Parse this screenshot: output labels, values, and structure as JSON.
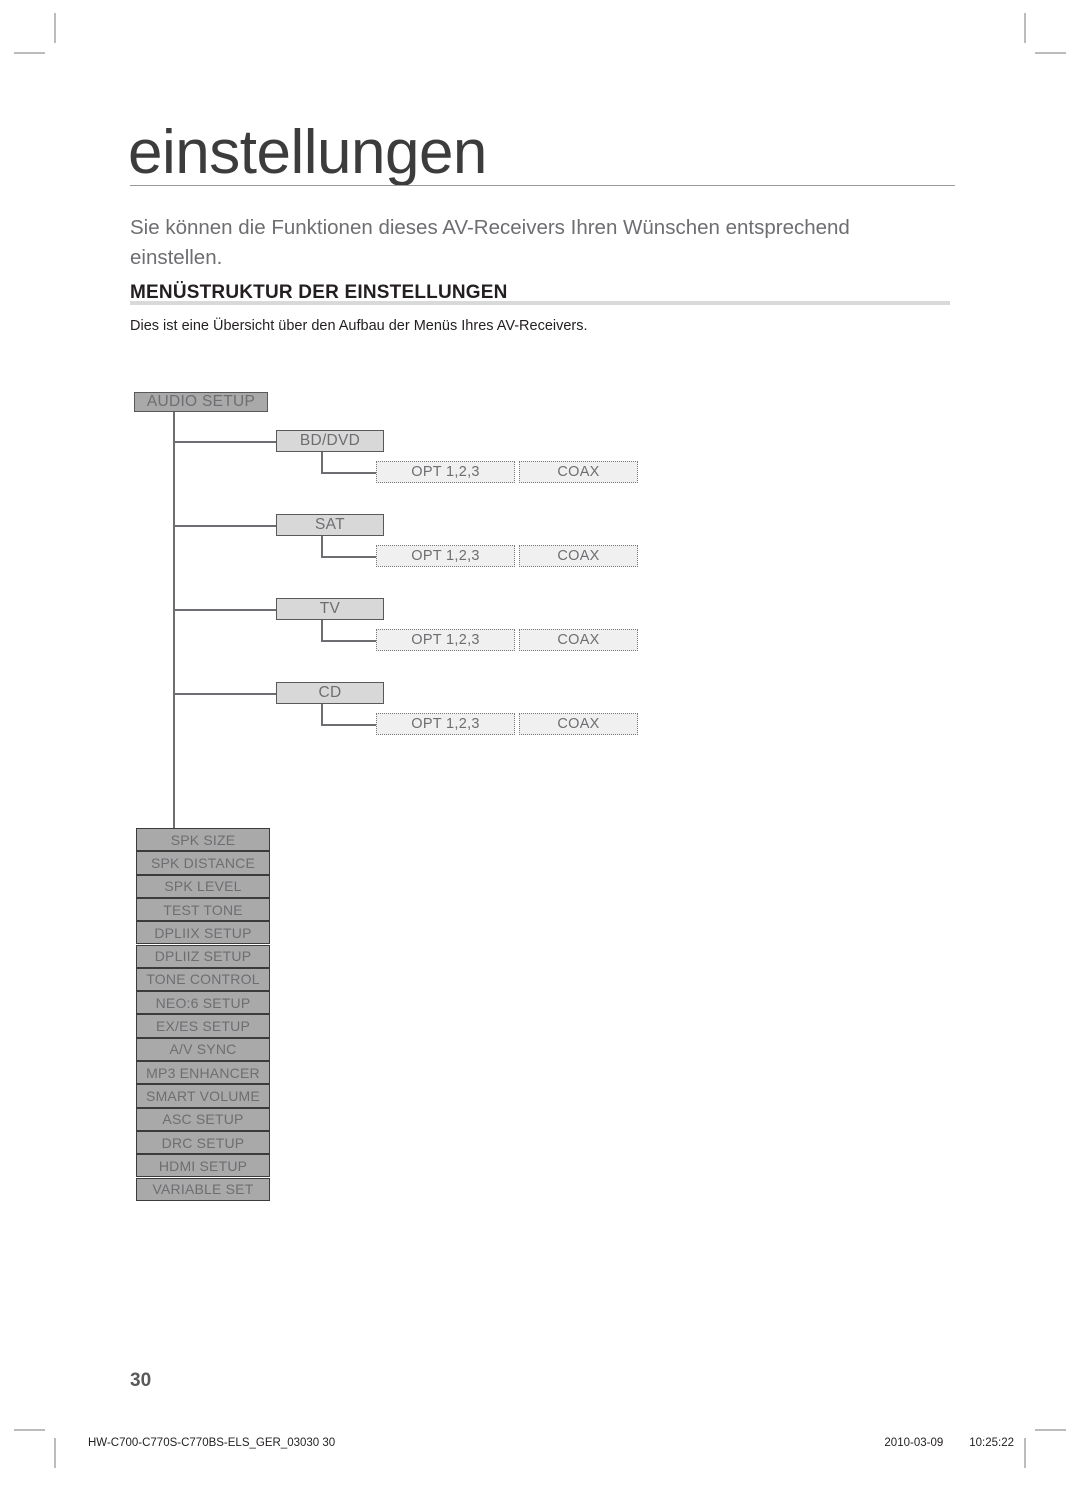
{
  "page": {
    "chapter_title": "einstellungen",
    "intro": "Sie können die Funktionen dieses AV-Receivers Ihren Wünschen entsprechend einstellen.",
    "section_heading": "MENÜSTRUKTUR DER EINSTELLUNGEN",
    "section_description": "Dies ist eine Übersicht über den Aufbau der Menüs Ihres AV-Receivers.",
    "page_number": "30"
  },
  "footer": {
    "document_id": "HW-C700-C770S-C770BS-ELS_GER_03030   30",
    "date": "2010-03-09",
    "time": "10:25:22"
  },
  "diagram": {
    "root": {
      "label": "AUDIO SETUP"
    },
    "sources": [
      {
        "label": "BD/DVD",
        "options": [
          {
            "label": "OPT 1,2,3"
          },
          {
            "label": "COAX"
          }
        ]
      },
      {
        "label": "SAT",
        "options": [
          {
            "label": "OPT 1,2,3"
          },
          {
            "label": "COAX"
          }
        ]
      },
      {
        "label": "TV",
        "options": [
          {
            "label": "OPT 1,2,3"
          },
          {
            "label": "COAX"
          }
        ]
      },
      {
        "label": "CD",
        "options": [
          {
            "label": "OPT 1,2,3"
          },
          {
            "label": "COAX"
          }
        ]
      }
    ],
    "menu_items": [
      {
        "label": "SPK SIZE"
      },
      {
        "label": "SPK DISTANCE"
      },
      {
        "label": "SPK LEVEL"
      },
      {
        "label": "TEST TONE"
      },
      {
        "label": "DPLIIX SETUP"
      },
      {
        "label": "DPLIIZ SETUP"
      },
      {
        "label": "TONE CONTROL"
      },
      {
        "label": "NEO:6 SETUP"
      },
      {
        "label": "EX/ES SETUP"
      },
      {
        "label": "A/V SYNC"
      },
      {
        "label": "MP3 ENHANCER"
      },
      {
        "label": "SMART VOLUME"
      },
      {
        "label": "ASC SETUP"
      },
      {
        "label": "DRC SETUP"
      },
      {
        "label": "HDMI SETUP"
      },
      {
        "label": "VARIABLE SET"
      }
    ]
  },
  "colors": {
    "root_fill": "#a9a9a9",
    "level2_fill": "#d8d8d8",
    "level3_fill": "#f0f0f0",
    "border": "#58595b",
    "text_gray": "#6d6e71",
    "rule": "#d9d9d9"
  }
}
